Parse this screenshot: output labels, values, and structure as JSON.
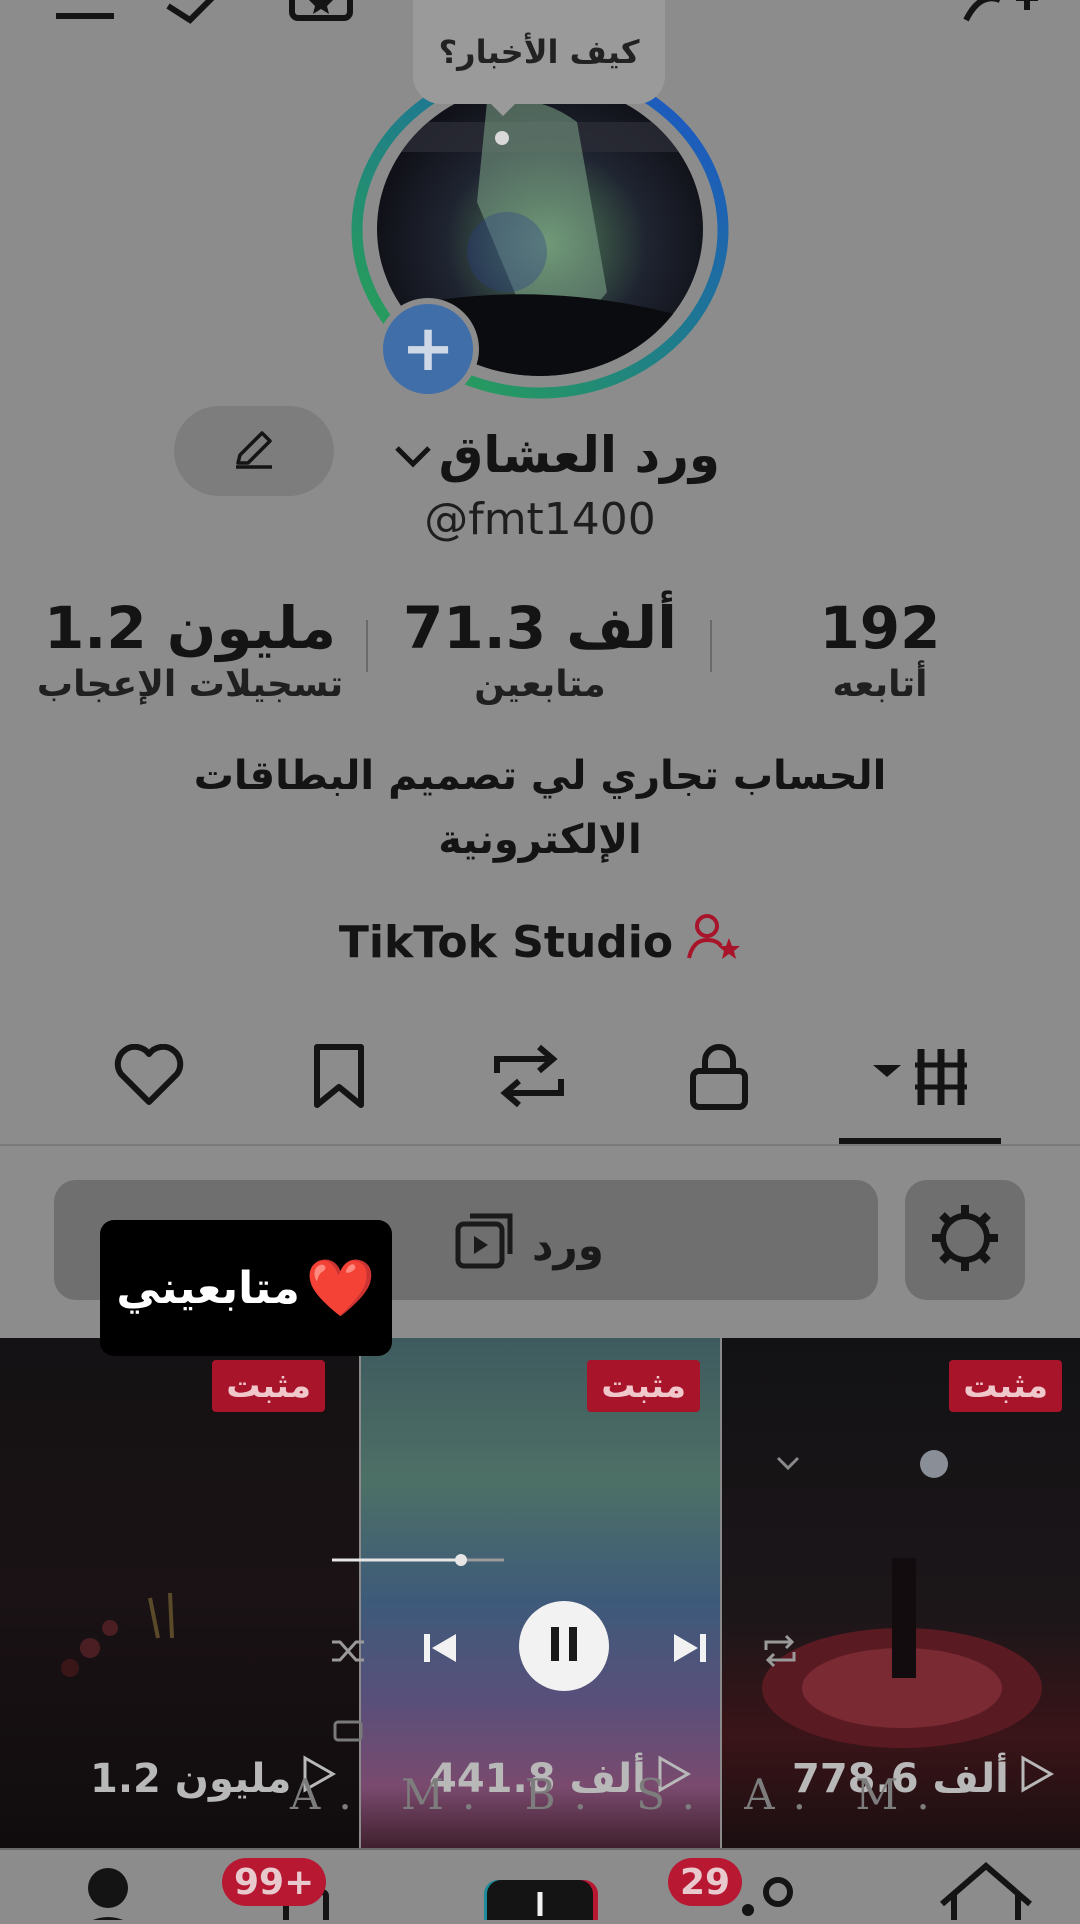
{
  "status_bubble": {
    "text": "كيف الأخبار؟"
  },
  "profile": {
    "display_name": "ورد العشاق",
    "handle": "@fmt1400",
    "bio_line1": "الحساب تجاري لي تصميم البطاقات",
    "bio_line2": "الإلكترونية",
    "studio_label": "TikTok Studio"
  },
  "stats": [
    {
      "value": "192",
      "label": "أتابعه"
    },
    {
      "value": "71.3 ألف",
      "label": "متابعين"
    },
    {
      "value": "1.2 مليون",
      "label": "تسجيلات الإعجاب"
    }
  ],
  "tabs": [
    "videos",
    "private",
    "reposts",
    "saved",
    "liked"
  ],
  "playlist_search": {
    "text": "ورد"
  },
  "sticker": {
    "text": "متابعيني",
    "emoji": "❤️"
  },
  "videos": [
    {
      "badge": "مثبت",
      "views": "778.6 ألف"
    },
    {
      "badge": "مثبت",
      "views": "441.8 ألف"
    },
    {
      "badge": "مثبت",
      "views": "1.2 مليون"
    }
  ],
  "player": {
    "progress": 0.75
  },
  "watermark": {
    "text": "A. M. B. S. A. M."
  },
  "bottom_nav": {
    "inbox_badge": "29",
    "friends_badge": "99+"
  },
  "colors": {
    "accent_red": "#a8142a",
    "badge_red": "#b81832",
    "plus_blue": "#3f6ea8",
    "dim_overlay": "#8c8c8c"
  }
}
